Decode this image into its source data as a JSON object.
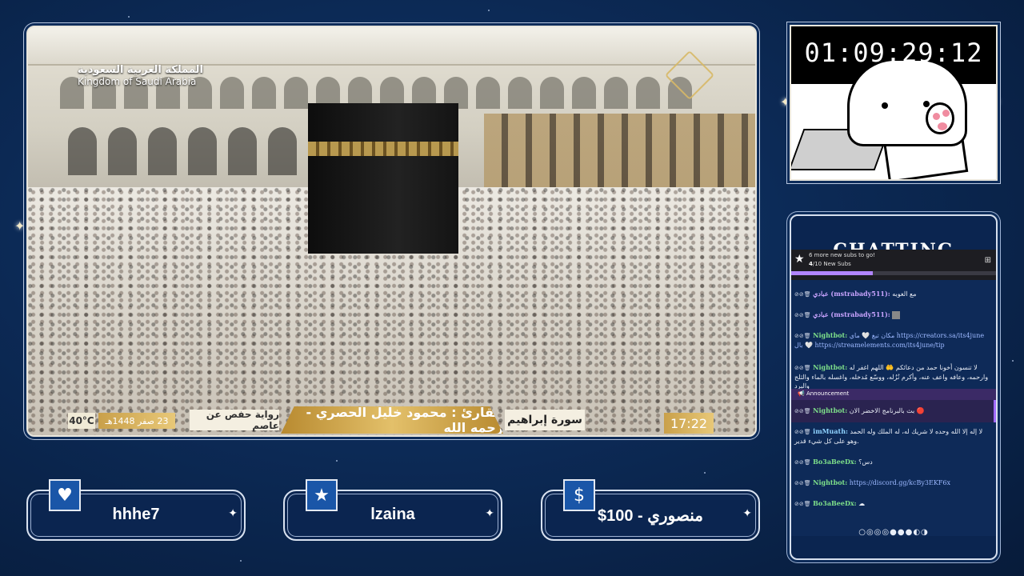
{
  "video": {
    "brand_ar": "المملكة العربية السعودية",
    "brand_en": "Kingdom of Saudi Arabia",
    "temperature": "40°C",
    "date": "23 صفر 1448هـ",
    "narration": "رواية حفص عن عاصم",
    "reciter": "القارئ : محمود خليل الحصري - رحمه الله",
    "surah": "سورة إبراهيم",
    "clock": "17:22"
  },
  "timer": {
    "value": "01:09:29:12"
  },
  "chat": {
    "title": "CHATTING",
    "goal": {
      "headline": "6 more new subs to go!",
      "progress_current": "4",
      "progress_text": "/10 New Subs",
      "progress_fraction": 0.4
    },
    "messages": [
      {
        "user": "عبادي (mstrabady511):",
        "text": "مع الغوبه",
        "color": "#c9a4ff"
      },
      {
        "user": "عبادي (mstrabady511):",
        "text": "",
        "color": "#c9a4ff"
      },
      {
        "user": "Nightbot:",
        "text": "مكان تبغ 🤍 ماي https://creators.sa/its4june بال 🤍 https://streamelements.com/its4june/tip",
        "color": "#7ee08a"
      },
      {
        "user": "Nightbot:",
        "text": "لا تنسون أخونا حمد من دعائكم 🤲 اللهم اغفر له وارحمه، وعافه واعف عنه، وأكرم نُزُله، ووسّع مُدخله، واغسله بالماء والثلج والبرد",
        "color": "#7ee08a"
      },
      {
        "user": "Nightbot:",
        "text": "بث بالبرنامج الاخضر الان 🔴",
        "color": "#7ee08a"
      },
      {
        "user": "imMuath:",
        "text": "لا إله إلا الله وحده لا شريك له، له الملك وله الحمد وهو على كل شيء قدير.",
        "color": "#8fd2ff"
      },
      {
        "user": "Bo3aBeeDx:",
        "text": "دس؟",
        "color": "#7ee08a"
      },
      {
        "user": "Nightbot:",
        "text": "https://discord.gg/kcBy3EKF6x",
        "color": "#7ee08a"
      },
      {
        "user": "Bo3aBeeDx:",
        "text": "",
        "color": "#7ee08a"
      }
    ],
    "announcement_label": "Announcement"
  },
  "alerts": [
    {
      "icon": "heart-icon",
      "text": "hhhe7"
    },
    {
      "icon": "star-icon",
      "text": "lzaina"
    },
    {
      "icon": "dollar-icon",
      "text": "منصوري - 100$"
    }
  ],
  "colors": {
    "background": "#0c2a56",
    "frame": "#e9e6dc",
    "accent_gold": "#c9a04a",
    "goal_fill": "#b185ff",
    "announce": "#a06bff"
  }
}
